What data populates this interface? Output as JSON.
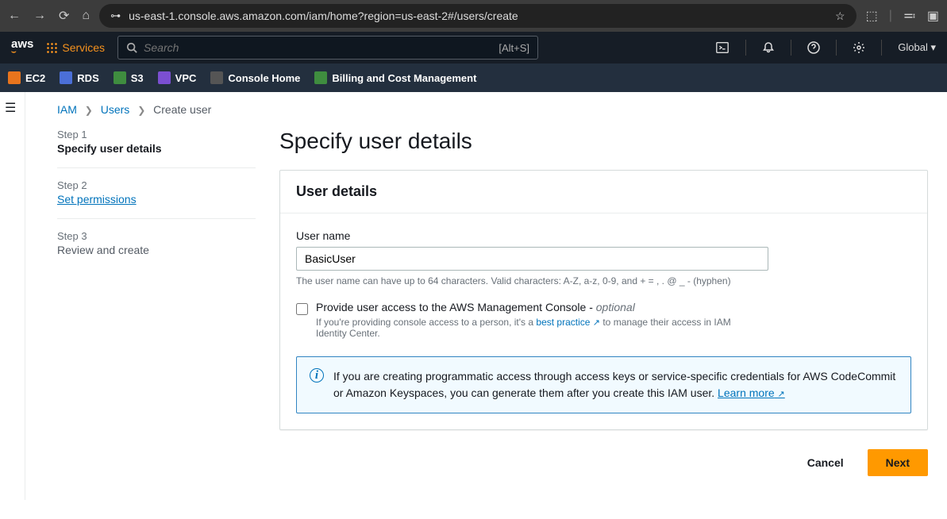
{
  "browser": {
    "url": "us-east-1.console.aws.amazon.com/iam/home?region=us-east-2#/users/create"
  },
  "aws_nav": {
    "services_label": "Services",
    "search_placeholder": "Search",
    "search_shortcut": "[Alt+S]",
    "region_label": "Global ▾"
  },
  "svc_bar": {
    "items": [
      {
        "label": "EC2"
      },
      {
        "label": "RDS"
      },
      {
        "label": "S3"
      },
      {
        "label": "VPC"
      },
      {
        "label": "Console Home"
      },
      {
        "label": "Billing and Cost Management"
      }
    ]
  },
  "breadcrumb": {
    "root": "IAM",
    "mid": "Users",
    "current": "Create user"
  },
  "steps": [
    {
      "num": "Step 1",
      "title": "Specify user details"
    },
    {
      "num": "Step 2",
      "title": "Set permissions"
    },
    {
      "num": "Step 3",
      "title": "Review and create"
    }
  ],
  "page": {
    "title": "Specify user details",
    "panel_header": "User details",
    "username_label": "User name",
    "username_value": "BasicUser",
    "username_hint": "The user name can have up to 64 characters. Valid characters: A-Z, a-z, 0-9, and + = , . @ _ - (hyphen)",
    "console_checkbox_label": "Provide user access to the AWS Management Console - ",
    "console_optional": "optional",
    "console_hint_pre": "If you're providing console access to a person, it's a ",
    "console_hint_link": "best practice",
    "console_hint_post": " to manage their access in IAM Identity Center.",
    "info_text_pre": "If you are creating programmatic access through access keys or service-specific credentials for AWS CodeCommit or Amazon Keyspaces, you can generate them after you create this IAM user. ",
    "info_learn_more": "Learn more"
  },
  "actions": {
    "cancel": "Cancel",
    "next": "Next"
  }
}
